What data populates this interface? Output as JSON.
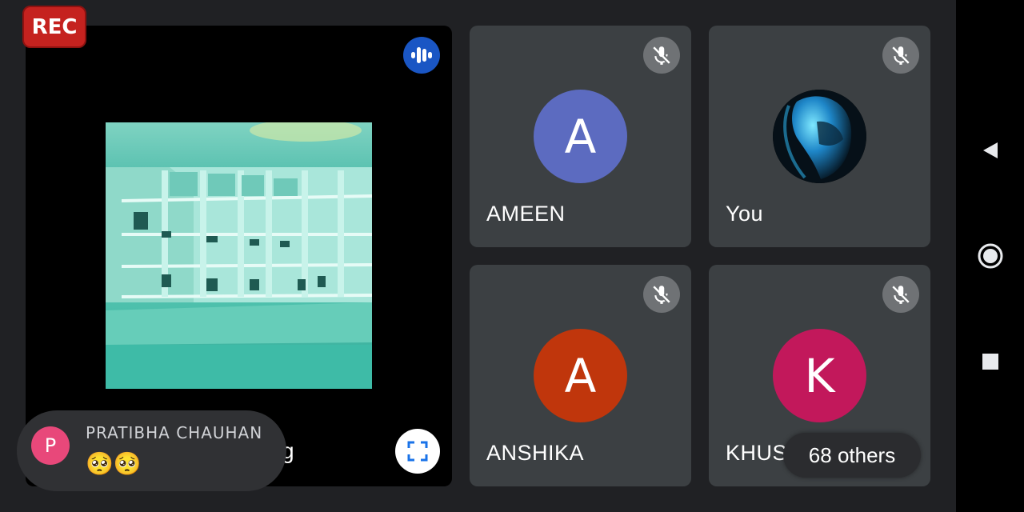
{
  "recording_badge": {
    "label": "REC"
  },
  "presenter": {
    "name_suffix": "g",
    "audio_icon": "audio-level-icon",
    "fullscreen_icon": "fullscreen-icon"
  },
  "participants": [
    {
      "name": "AMEEN",
      "initial": "A",
      "avatar_color": "#5c6bc0",
      "muted": true
    },
    {
      "name": "You",
      "initial": "",
      "avatar_color": "#000000",
      "muted": true
    },
    {
      "name": "ANSHIKA",
      "initial": "A",
      "avatar_color": "#c0360c",
      "muted": true
    },
    {
      "name": "KHUSHBU",
      "initial": "K",
      "avatar_color": "#c2185b",
      "muted": true
    }
  ],
  "others_chip": {
    "label": "68 others"
  },
  "chat_toast": {
    "sender": "PRATIBHA CHAUHAN",
    "initial": "P",
    "avatar_color": "#e8487a",
    "message": "🥺🥺"
  },
  "colors": {
    "background": "#202124",
    "tile": "#3c4043",
    "rec": "#c5221f",
    "accent_blue": "#1a56c4"
  },
  "system_nav": [
    "back-icon",
    "home-icon",
    "recents-icon"
  ]
}
